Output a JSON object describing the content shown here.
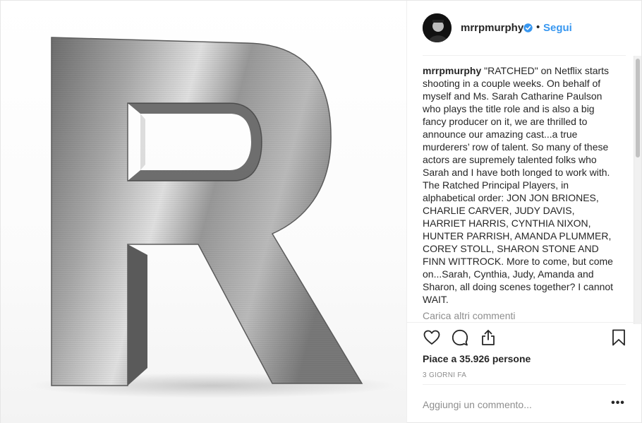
{
  "post": {
    "image_alt": "Brushed metal letter R",
    "image_letter": "R"
  },
  "header": {
    "username": "mrrpmurphy",
    "separator": "•",
    "follow_label": "Segui",
    "verified_icon": "verified-badge-icon",
    "avatar_icon": "avatar-icon"
  },
  "caption": {
    "username": "mrrpmurphy",
    "text": "\"RATCHED\" on Netflix starts shooting in a couple weeks. On behalf of myself and Ms. Sarah Catharine Paulson who plays the title role and is also a big fancy producer on it, we are thrilled to announce our amazing cast...a true murderers’ row of talent. So many of these actors are supremely talented folks who Sarah and I have both longed to work with. The Ratched Principal Players, in alphabetical order: JON JON BRIONES, CHARLIE CARVER, JUDY DAVIS, HARRIET HARRIS, CYNTHIA NIXON, HUNTER PARRISH, AMANDA PLUMMER, COREY STOLL, SHARON STONE AND FINN WITTROCK. More to come, but come on...Sarah, Cynthia, Judy, Amanda and Sharon, all doing scenes together? I cannot WAIT.",
    "load_more": "Carica altri commenti"
  },
  "actions": {
    "like_icon": "heart-icon",
    "comment_icon": "comment-icon",
    "share_icon": "share-icon",
    "save_icon": "bookmark-icon"
  },
  "likes": "Piace a 35.926 persone",
  "timestamp": "3 GIORNI FA",
  "comment": {
    "placeholder": "Aggiungi un commento...",
    "options_label": "•••"
  },
  "colors": {
    "accent": "#3897f0",
    "text": "#262626",
    "muted": "#8e8e8e",
    "divider": "#efefef"
  }
}
